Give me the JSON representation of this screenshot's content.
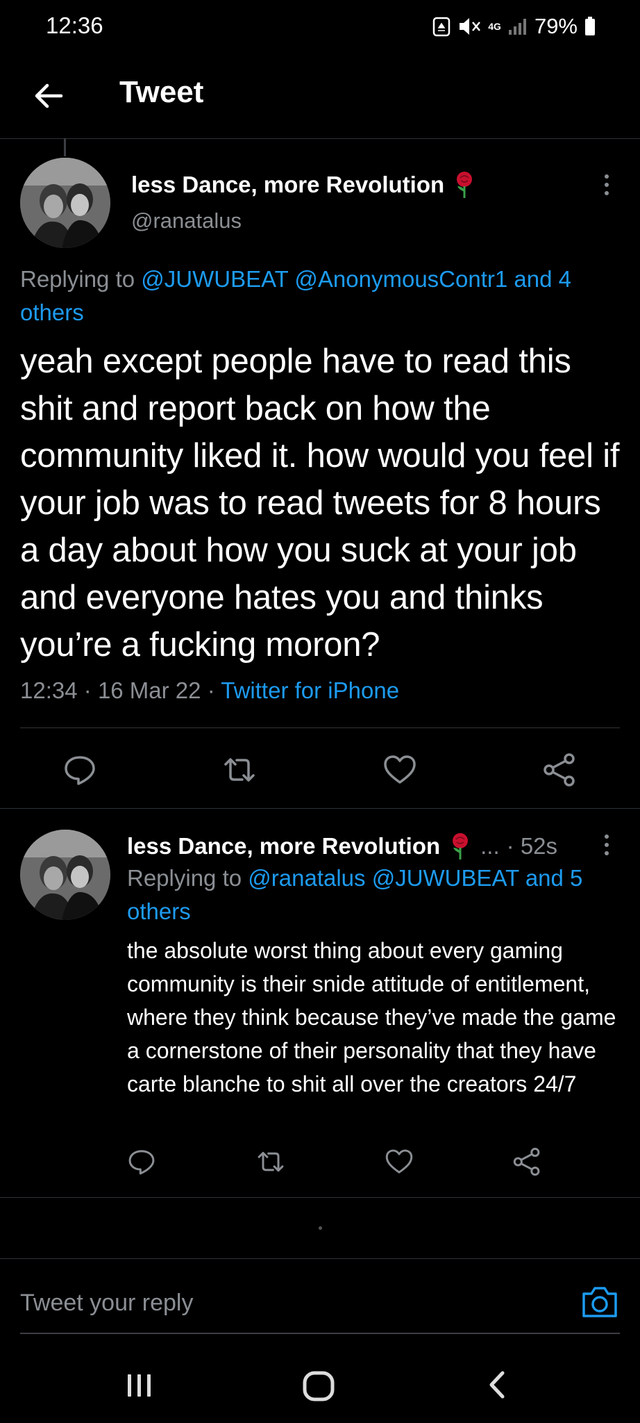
{
  "status_bar": {
    "time": "12:36",
    "network": "4G",
    "battery": "79%"
  },
  "header": {
    "title": "Tweet",
    "back_icon": "arrow-left-icon"
  },
  "main_tweet": {
    "author_name": "less Dance, more Revolution",
    "handle": "@ranatalus",
    "emoji": "rose",
    "replying_prefix": "Replying to",
    "replying_to": "@JUWUBEAT @AnonymousContr1 and 4 others",
    "text": "yeah except people have to read this shit and report back on how the community liked it. how would you feel if your job was to read tweets for 8 hours a day about how you suck at your job and everyone hates you and thinks you’re a fucking moron?",
    "time": "12:34",
    "date": "16 Mar 22",
    "source": "Twitter for iPhone",
    "actions": [
      "reply-icon",
      "retweet-icon",
      "like-icon",
      "share-icon"
    ]
  },
  "reply_tweet": {
    "author_name": "less Dance, more Revolution",
    "ellipsis": "...",
    "relative_time": "· 52s",
    "replying_prefix": "Replying to",
    "replying_to": "@ranatalus @JUWUBEAT and 5 others",
    "text": "the absolute worst thing about every gaming community is their snide attitude of entitlement, where they think because they’ve made the game a cornerstone of their personality that they have carte blanche to shit all over the creators 24/7"
  },
  "compose": {
    "placeholder": "Tweet your reply"
  },
  "colors": {
    "background": "#000000",
    "accent": "#1d9bf0",
    "text": "#e7e9ea",
    "secondary": "#8b8f94",
    "divider": "#2f3336"
  }
}
